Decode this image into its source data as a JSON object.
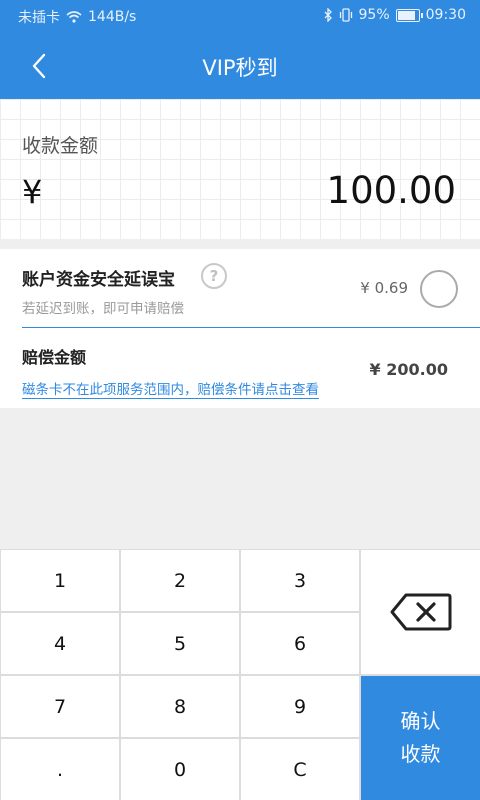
{
  "status_bar": {
    "carrier": "未插卡",
    "speed": "144B/s",
    "battery": "95%",
    "battery_level": 0.95,
    "time": "09:30"
  },
  "header": {
    "title": "VIP秒到"
  },
  "amount": {
    "label": "收款金额",
    "currency": "¥",
    "value": "100.00"
  },
  "insurance": {
    "title": "账户资金安全延误宝",
    "help": "?",
    "subtitle": "若延迟到账，即可申请赔偿",
    "price": "¥ 0.69"
  },
  "compensation": {
    "label": "赔偿金额",
    "link": "磁条卡不在此项服务范围内，赔偿条件请点击查看",
    "amount": "¥ 200.00"
  },
  "keypad": {
    "keys": [
      "1",
      "2",
      "3",
      "4",
      "5",
      "6",
      "7",
      "8",
      "9",
      ".",
      "0",
      "C"
    ],
    "confirm_line1": "确认",
    "confirm_line2": "收款"
  },
  "colors": {
    "accent": "#2f8ae0"
  }
}
